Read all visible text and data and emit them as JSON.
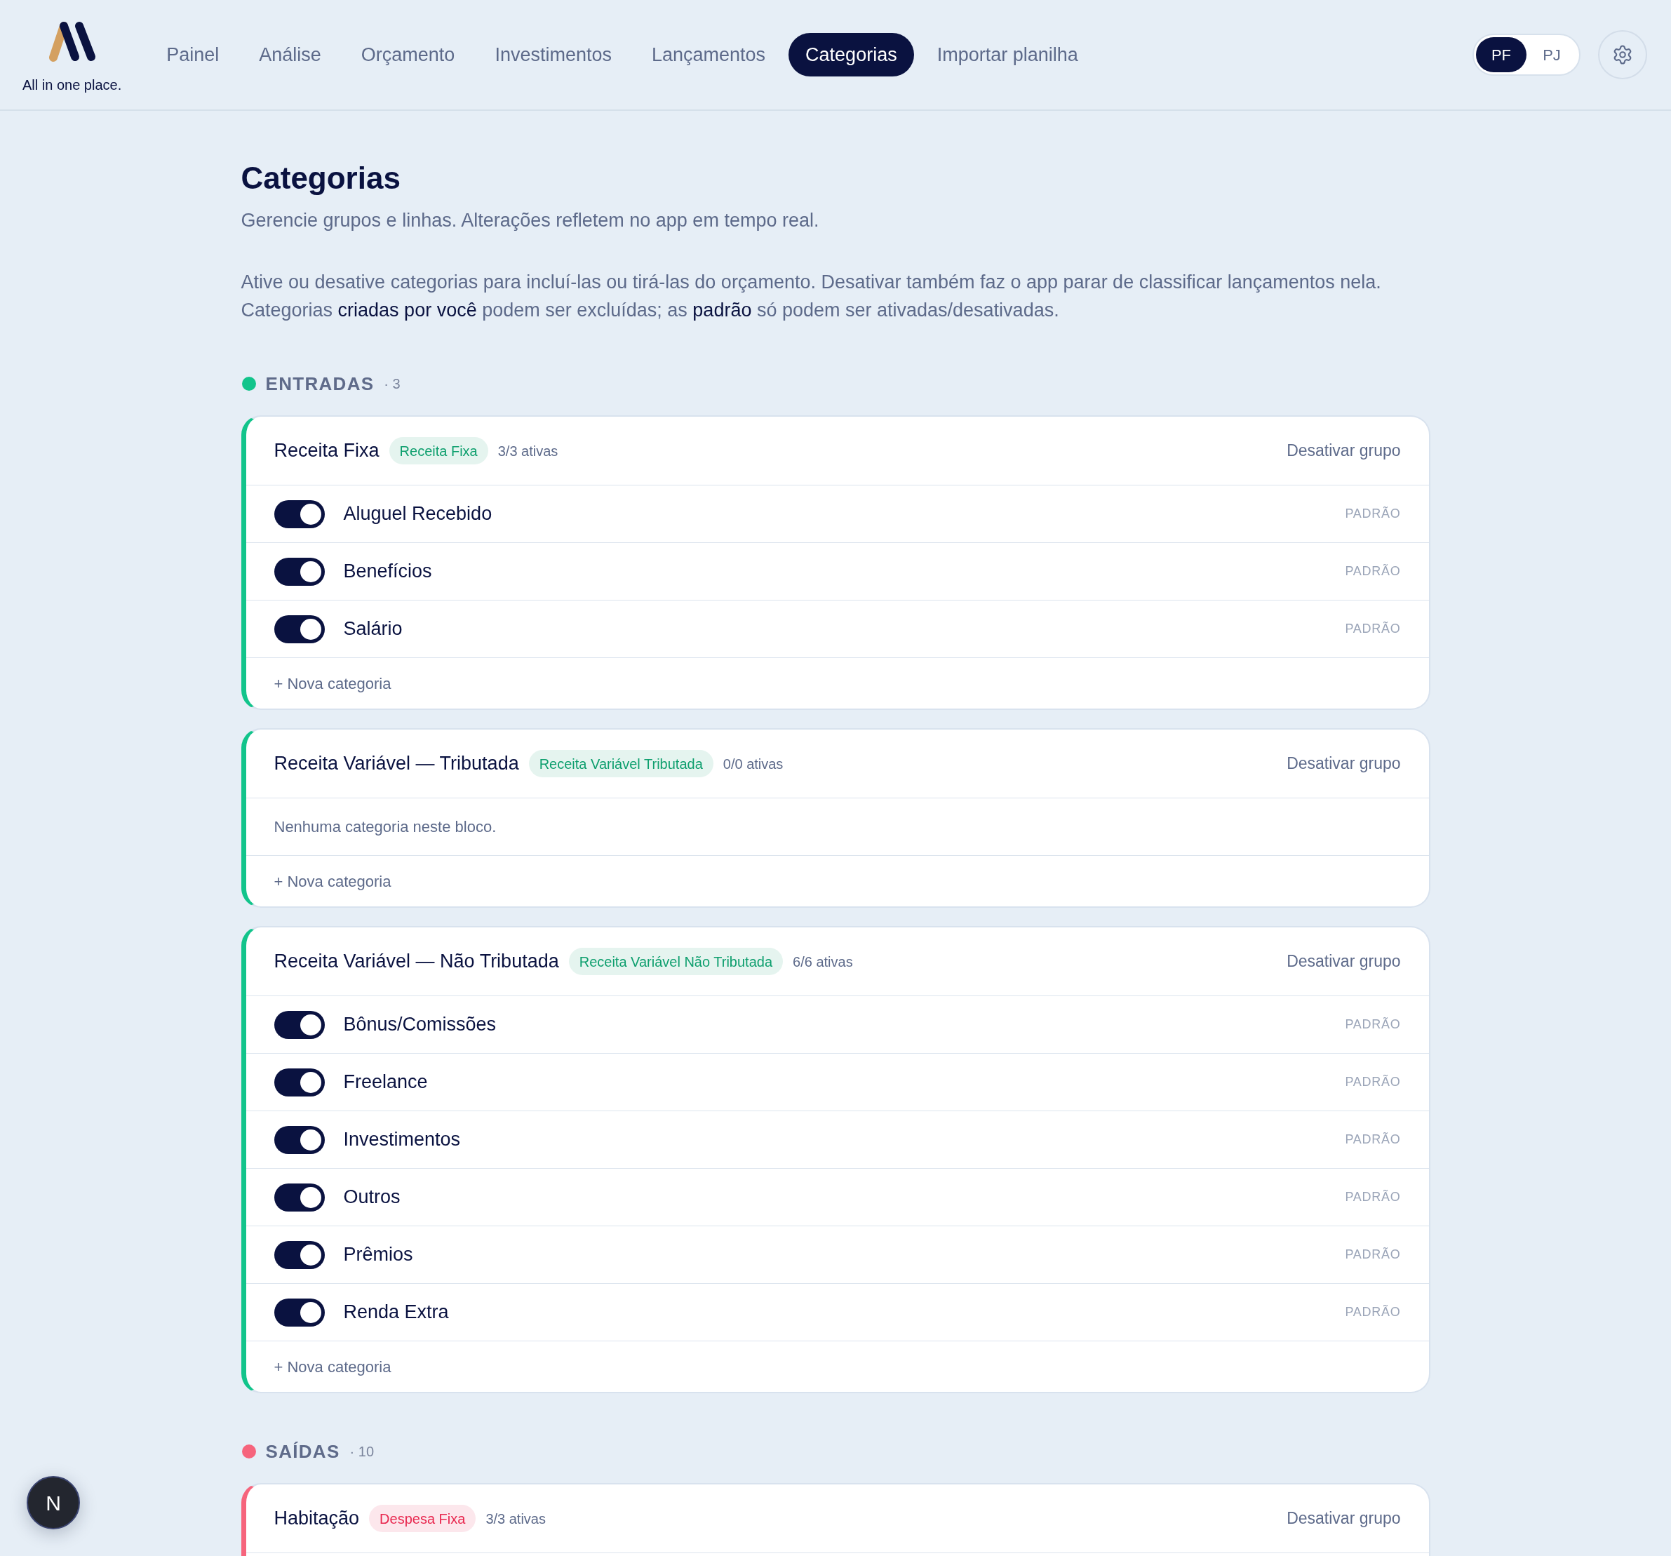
{
  "header": {
    "logo_tagline": "All in one place.",
    "nav": [
      {
        "label": "Painel",
        "selected": false
      },
      {
        "label": "Análise",
        "selected": false
      },
      {
        "label": "Orçamento",
        "selected": false
      },
      {
        "label": "Investimentos",
        "selected": false
      },
      {
        "label": "Lançamentos",
        "selected": false
      },
      {
        "label": "Categorias",
        "selected": true
      },
      {
        "label": "Importar planilha",
        "selected": false
      }
    ],
    "profile_switch": [
      {
        "label": "PF",
        "selected": true
      },
      {
        "label": "PJ",
        "selected": false
      }
    ]
  },
  "page": {
    "title": "Categorias",
    "subtitle": "Gerencie grupos e linhas. Alterações refletem no app em tempo real.",
    "intro_lines": [
      "Ative ou desative categorias para incluí-las ou tirá-las do orçamento. Desativar também faz o app parar de classificar lançamentos nela.",
      "Categorias **criadas por você** podem ser excluídas; as **padrão** só podem ser ativadas/desativadas."
    ]
  },
  "sections": [
    {
      "title": "ENTRADAS",
      "count": "· 3",
      "color": "#12c48b",
      "groups": [
        {
          "name": "Receita Fixa",
          "badge": {
            "label": "Receita Fixa",
            "color": "#0e9f6e"
          },
          "active_count": "3/3 ativas",
          "action": "Desativar grupo",
          "categories": [
            {
              "name": "Aluguel Recebido",
              "on": true,
              "tag": "PADRÃO"
            },
            {
              "name": "Benefícios",
              "on": true,
              "tag": "PADRÃO"
            },
            {
              "name": "Salário",
              "on": true,
              "tag": "PADRÃO"
            }
          ],
          "add_label": "+ Nova categoria"
        },
        {
          "name": "Receita Variável — Tributada",
          "badge": {
            "label": "Receita Variável Tributada",
            "color": "#0e9f6e"
          },
          "active_count": "0/0 ativas",
          "action": "Desativar grupo",
          "empty_text": "Nenhuma categoria neste bloco.",
          "add_label": "+ Nova categoria"
        },
        {
          "name": "Receita Variável — Não Tributada",
          "badge": {
            "label": "Receita Variável Não Tributada",
            "color": "#0e9f6e"
          },
          "active_count": "6/6 ativas",
          "action": "Desativar grupo",
          "categories": [
            {
              "name": "Bônus/Comissões",
              "on": true,
              "tag": "PADRÃO"
            },
            {
              "name": "Freelance",
              "on": true,
              "tag": "PADRÃO"
            },
            {
              "name": "Investimentos",
              "on": true,
              "tag": "PADRÃO"
            },
            {
              "name": "Outros",
              "on": true,
              "tag": "PADRÃO"
            },
            {
              "name": "Prêmios",
              "on": true,
              "tag": "PADRÃO"
            },
            {
              "name": "Renda Extra",
              "on": true,
              "tag": "PADRÃO"
            }
          ],
          "add_label": "+ Nova categoria"
        }
      ]
    },
    {
      "title": "SAÍDAS",
      "count": "· 10",
      "color": "#f6647c",
      "groups": [
        {
          "name": "Habitação",
          "badge": {
            "label": "Despesa Fixa",
            "color": "#e8284f"
          },
          "active_count": "3/3 ativas",
          "action": "Desativar grupo",
          "continues": true
        }
      ]
    }
  ],
  "dev_button": {
    "label": "N"
  }
}
